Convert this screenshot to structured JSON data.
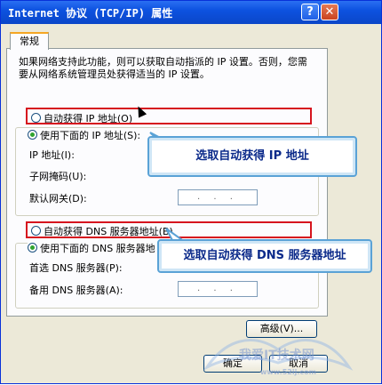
{
  "window": {
    "title": "Internet 协议 (TCP/IP) 属性",
    "help_glyph": "?",
    "close_glyph": "✕"
  },
  "tabs": {
    "general": "常规"
  },
  "description": "如果网络支持此功能，则可以获取自动指派的 IP 设置。否则，您需要从网络系统管理员处获得适当的 IP 设置。",
  "ip_section": {
    "auto_label": "自动获得 IP 地址(O)",
    "manual_label": "使用下面的 IP 地址(S):",
    "ip_address_label": "IP 地址(I):",
    "subnet_label": "子网掩码(U):",
    "gateway_label": "默认网关(D):",
    "ip_placeholder": ". . .",
    "selected": "manual"
  },
  "dns_section": {
    "auto_label": "自动获得 DNS 服务器地址(B)",
    "manual_label": "使用下面的 DNS 服务器地",
    "preferred_label": "首选 DNS 服务器(P):",
    "alternate_label": "备用 DNS 服务器(A):",
    "ip_placeholder": ". . .",
    "selected": "manual"
  },
  "callouts": {
    "ip": "选取自动获得 IP 地址",
    "dns": "选取自动获得 DNS 服务器地址"
  },
  "buttons": {
    "advanced": "高级(V)...",
    "ok": "确定",
    "cancel": "取消"
  },
  "watermark": {
    "text": "我爱IT技术网",
    "url": "www.52ij.com"
  },
  "colors": {
    "title_bar": "#0d52e0",
    "highlight": "#d6141e",
    "callout_border": "#5aa2d6",
    "callout_text": "#0b2a8a"
  }
}
